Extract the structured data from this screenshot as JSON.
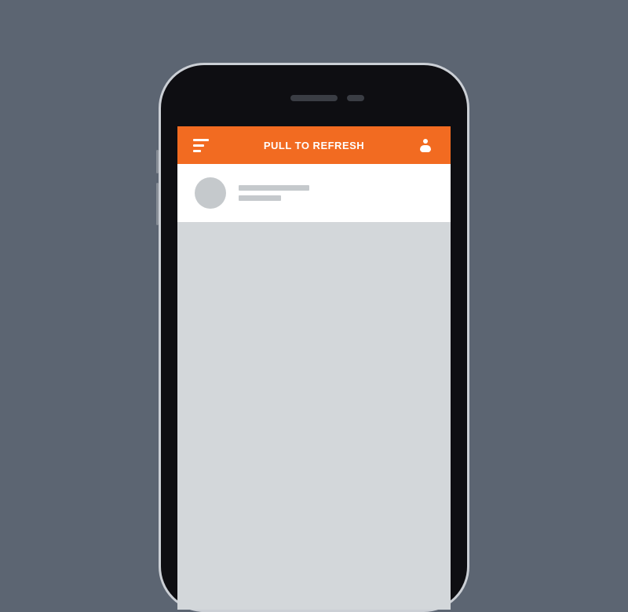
{
  "header": {
    "title": "PULL TO REFRESH"
  },
  "colors": {
    "accent": "#f26b21",
    "background": "#5c6572",
    "placeholder": "#c5c9cc"
  }
}
